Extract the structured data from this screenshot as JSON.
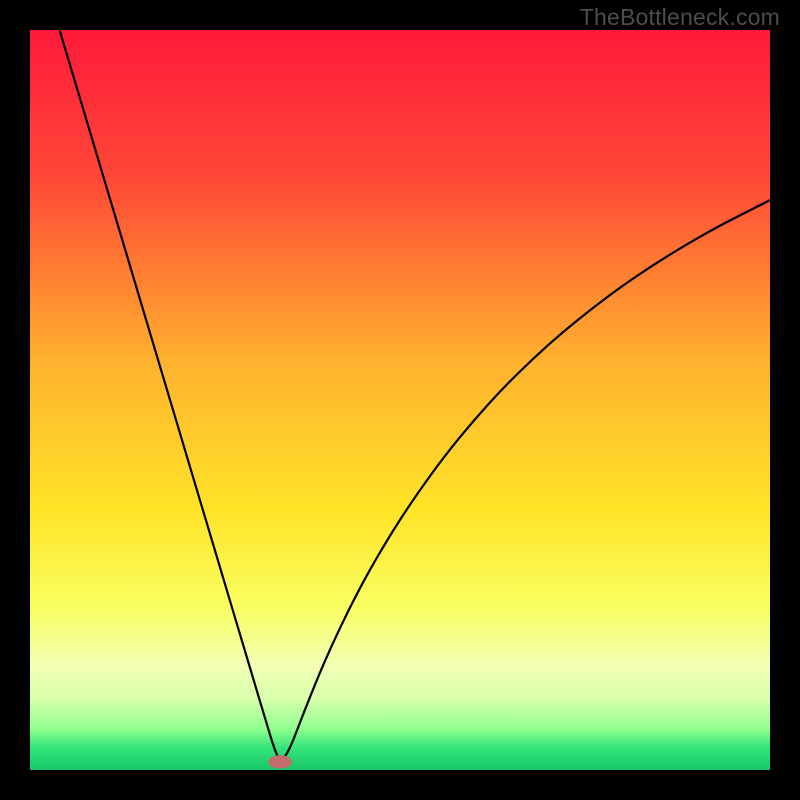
{
  "watermark": "TheBottleneck.com",
  "colors": {
    "background": "#000000",
    "curve": "#000000",
    "marker_fill": "#c56c6c",
    "gradient_stops": [
      {
        "offset": 0.0,
        "color": "#ff1a3a"
      },
      {
        "offset": 0.2,
        "color": "#ff4837"
      },
      {
        "offset": 0.45,
        "color": "#ffb22e"
      },
      {
        "offset": 0.65,
        "color": "#ffe428"
      },
      {
        "offset": 0.78,
        "color": "#f9ff62"
      },
      {
        "offset": 0.86,
        "color": "#f2ffb4"
      },
      {
        "offset": 0.905,
        "color": "#d6ffac"
      },
      {
        "offset": 0.945,
        "color": "#8fff8f"
      },
      {
        "offset": 0.97,
        "color": "#34e47a"
      },
      {
        "offset": 1.0,
        "color": "#18c766"
      }
    ]
  },
  "chart_data": {
    "type": "line",
    "title": "",
    "xlabel": "",
    "ylabel": "",
    "xlim": [
      0,
      100
    ],
    "ylim": [
      0,
      100
    ],
    "legend": false,
    "grid": false,
    "series": [
      {
        "name": "curve",
        "x": [
          4,
          6,
          8,
          10,
          12,
          14,
          16,
          18,
          20,
          22,
          24,
          26,
          28,
          30,
          32,
          33,
          33.8,
          35,
          37,
          40,
          44,
          48,
          52,
          56,
          60,
          64,
          68,
          72,
          76,
          80,
          84,
          88,
          92,
          96,
          100
        ],
        "y": [
          100,
          93.3,
          86.6,
          79.9,
          73.2,
          66.5,
          59.8,
          53.1,
          46.4,
          39.7,
          33.0,
          26.3,
          19.6,
          12.9,
          6.2,
          2.9,
          1.1,
          2.5,
          7.8,
          15.2,
          23.6,
          30.7,
          36.9,
          42.4,
          47.3,
          51.7,
          55.6,
          59.2,
          62.4,
          65.4,
          68.1,
          70.6,
          72.9,
          75.0,
          77.0
        ]
      }
    ],
    "marker": {
      "x": 33.8,
      "y": 1.1,
      "rx": 1.6,
      "ry": 0.9
    }
  }
}
